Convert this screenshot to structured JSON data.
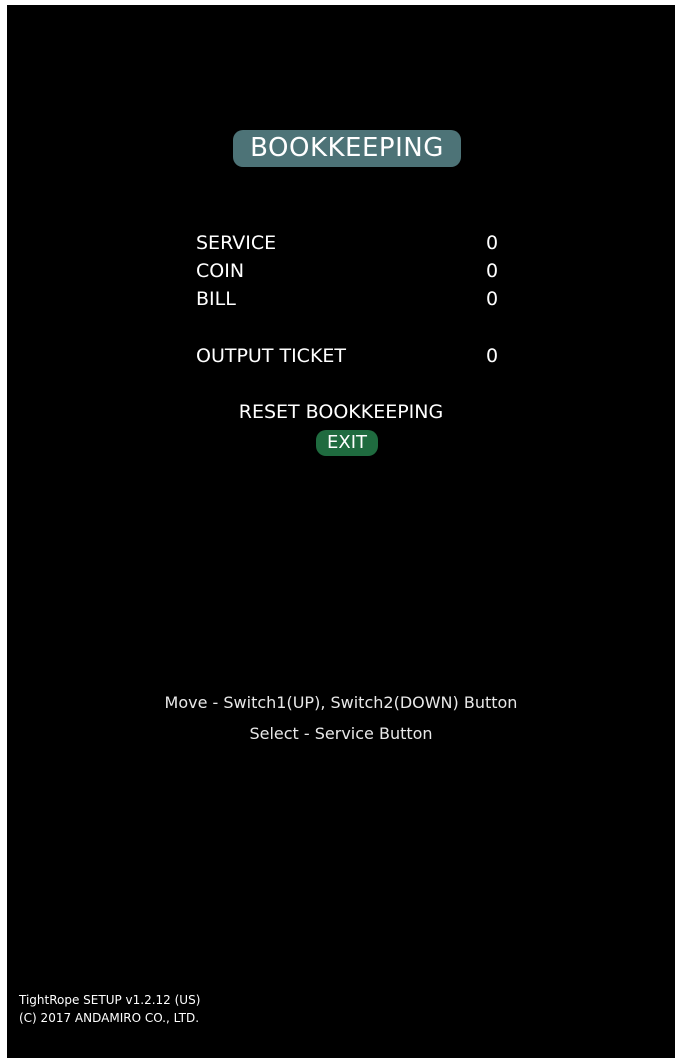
{
  "title": "BOOKKEEPING",
  "rows": [
    {
      "label": "SERVICE",
      "value": "0"
    },
    {
      "label": "COIN",
      "value": "0"
    },
    {
      "label": "BILL",
      "value": "0"
    },
    {
      "label": "OUTPUT TICKET",
      "value": "0"
    }
  ],
  "menu": {
    "reset_label": "RESET BOOKKEEPING",
    "exit_label": "EXIT"
  },
  "help": {
    "move": "Move - Switch1(UP), Switch2(DOWN) Button",
    "select": "Select - Service Button"
  },
  "footer": {
    "version": "TightRope SETUP v1.2.12 (US)",
    "copyright": "(C) 2017 ANDAMIRO CO., LTD."
  },
  "colors": {
    "title_bg": "#4d7377",
    "exit_bg": "#1f6b3f",
    "background": "#000000",
    "text": "#ffffff"
  }
}
